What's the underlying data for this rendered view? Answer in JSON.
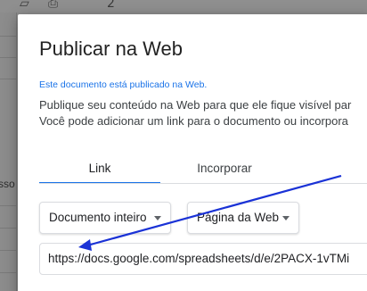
{
  "background": {
    "partial_text": "sso"
  },
  "dialog": {
    "title": "Publicar na Web",
    "published_notice": "Este documento está publicado na Web.",
    "description_line1": "Publique seu conteúdo na Web para que ele fique visível par",
    "description_line2": "Você pode adicionar um link para o documento ou incorpora",
    "tabs": [
      {
        "label": "Link",
        "active": true
      },
      {
        "label": "Incorporar",
        "active": false
      }
    ],
    "document_select": {
      "value": "Documento inteiro"
    },
    "format_select": {
      "value": "Página da Web"
    },
    "url_value": "https://docs.google.com/spreadsheets/d/e/2PACX-1vTMi"
  },
  "colors": {
    "accent": "#1a73e8",
    "annotation_arrow": "#1a32d6"
  },
  "icons": {
    "dropdown": "caret-down-icon",
    "annotation": "arrow-annotation"
  }
}
